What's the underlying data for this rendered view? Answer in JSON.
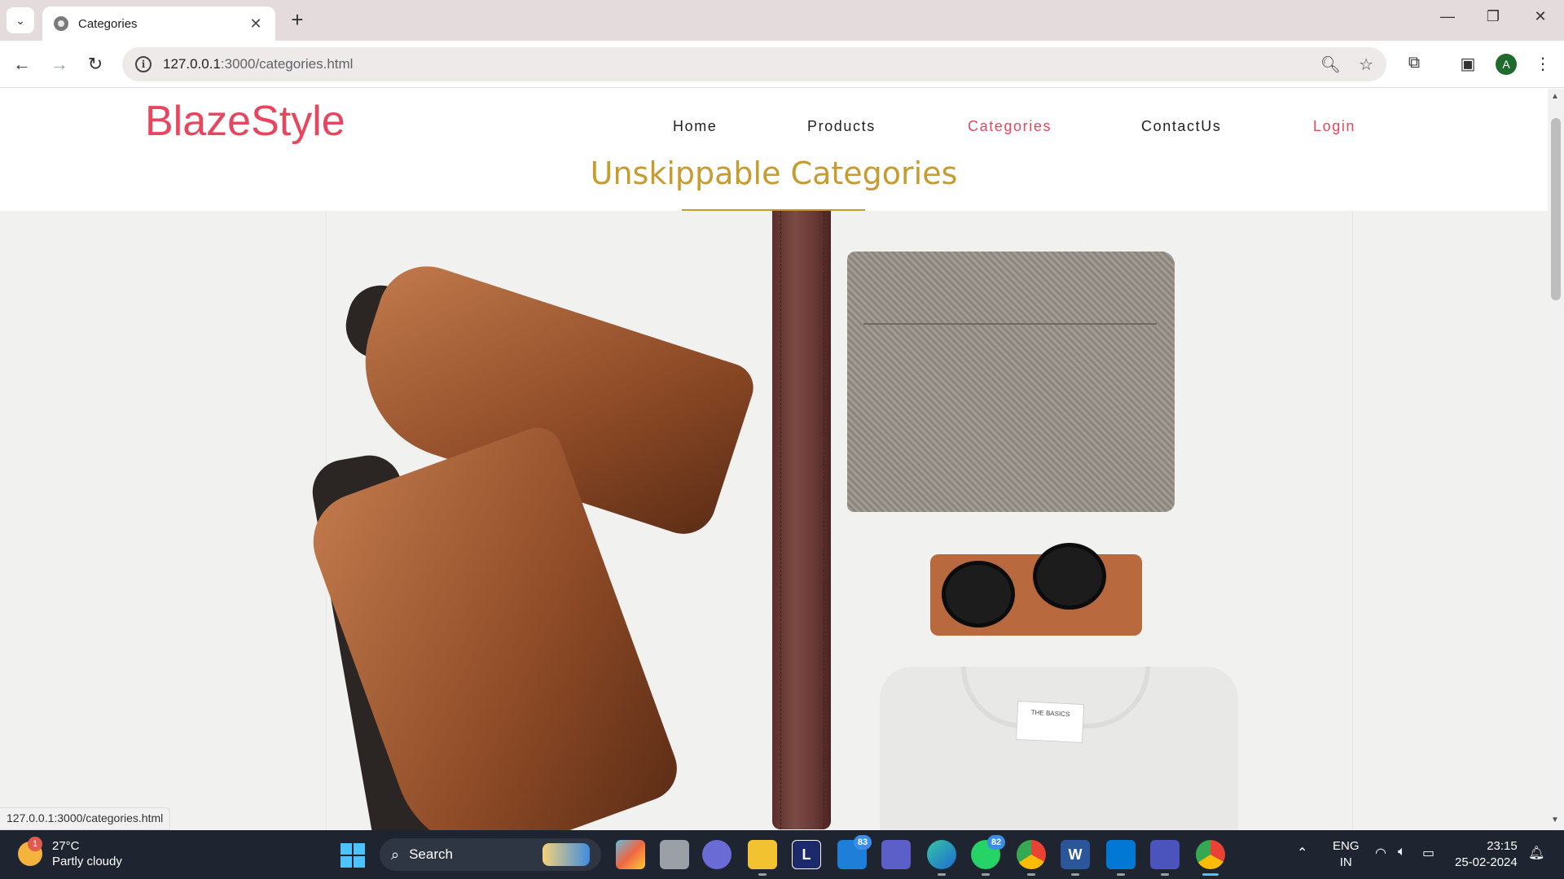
{
  "browser": {
    "tab_title": "Categories",
    "tab_close": "✕",
    "new_tab": "+",
    "url_host": "127.0.0.1",
    "url_rest": ":3000/categories.html",
    "status_url": "127.0.0.1:3000/categories.html",
    "profile_initial": "A"
  },
  "site": {
    "brand": "BlazeStyle",
    "nav": [
      "Home",
      "Products",
      "Categories",
      "ContactUs",
      "Login"
    ],
    "section_title": "Unskippable Categories",
    "shirt_label": "THE BASICS"
  },
  "taskbar": {
    "weather_temp": "27°C",
    "weather_desc": "Partly cloudy",
    "weather_badge": "1",
    "search_label": "Search",
    "mail_count": "83",
    "whatsapp_count": "82",
    "lang_top": "ENG",
    "lang_bottom": "IN",
    "time": "23:15",
    "date": "25-02-2024"
  },
  "colors": {
    "brand": "#e8455e",
    "section_title": "#c89b2e",
    "taskbar": "#1f2530"
  },
  "icons": [
    "tab-search-icon",
    "back-arrow-icon",
    "forward-arrow-icon",
    "reload-icon",
    "site-info-icon",
    "zoom-icon",
    "bookmark-star-icon",
    "extensions-icon",
    "side-panel-icon",
    "menu-dots-icon",
    "minimize-icon",
    "restore-icon",
    "close-icon",
    "wifi-icon",
    "volume-icon",
    "battery-icon",
    "notification-bell-icon",
    "chevron-up-icon"
  ]
}
